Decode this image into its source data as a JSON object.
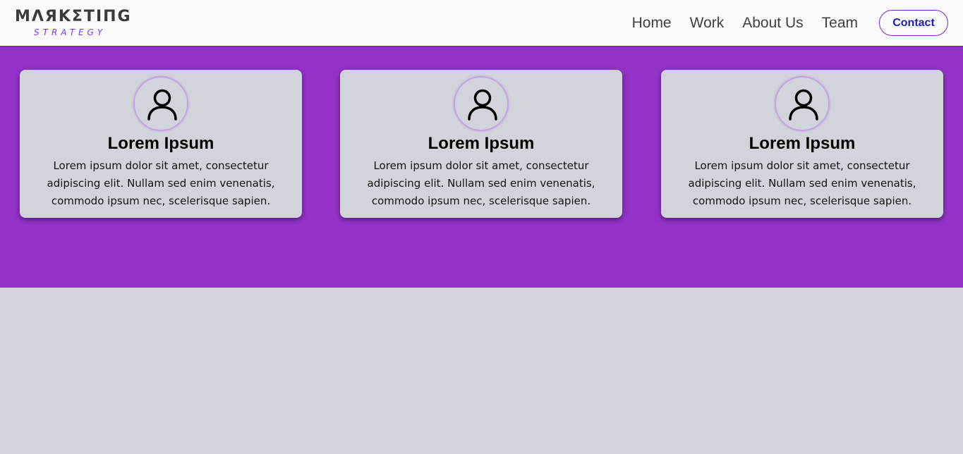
{
  "logo": {
    "main": "MΛЯKΣTIПG",
    "sub": "STRATEGY"
  },
  "nav": {
    "items": [
      "Home",
      "Work",
      "About Us",
      "Team"
    ],
    "contact_label": "Contact"
  },
  "colors": {
    "hero": "#9333ca",
    "page": "#d1d5db",
    "accent": "#7e22ce"
  },
  "cards": [
    {
      "icon": "user-icon",
      "title": "Lorem Ipsum",
      "text": "Lorem ipsum dolor sit amet, consectetur adipiscing elit. Nullam sed enim venenatis, commodo ipsum nec, scelerisque sapien."
    },
    {
      "icon": "user-icon",
      "title": "Lorem Ipsum",
      "text": "Lorem ipsum dolor sit amet, consectetur adipiscing elit. Nullam sed enim venenatis, commodo ipsum nec, scelerisque sapien."
    },
    {
      "icon": "user-icon",
      "title": "Lorem Ipsum",
      "text": "Lorem ipsum dolor sit amet, consectetur adipiscing elit. Nullam sed enim venenatis, commodo ipsum nec, scelerisque sapien."
    }
  ]
}
